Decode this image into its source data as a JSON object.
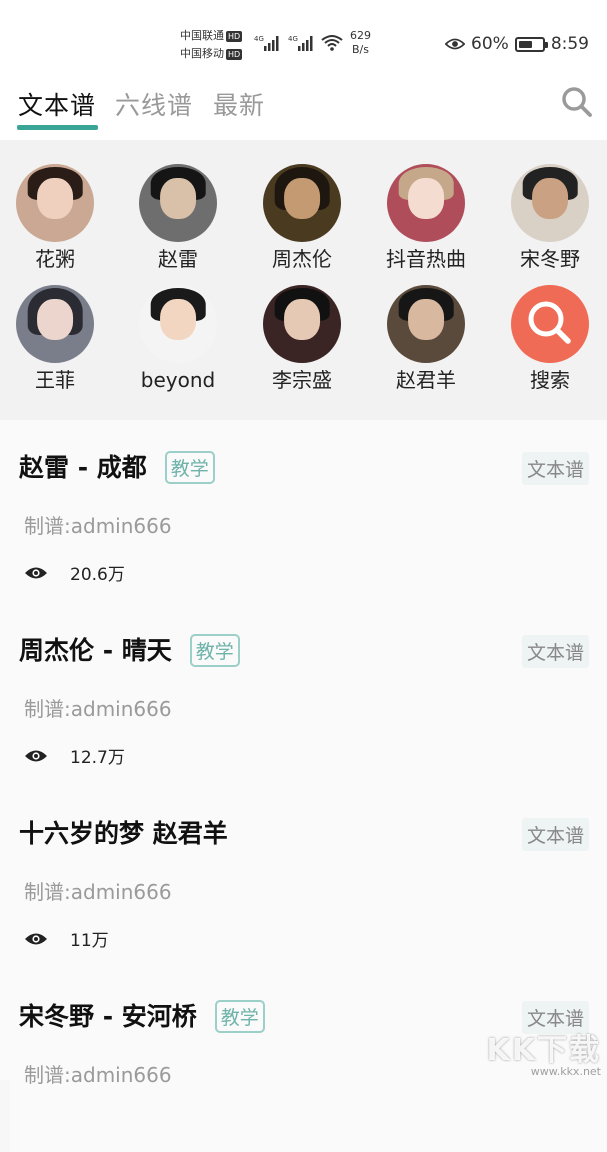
{
  "status_bar": {
    "carrier1": "中国联通",
    "carrier2": "中国移动",
    "hd": "HD",
    "net_type": "4G",
    "net_speed_value": "629",
    "net_speed_unit": "B/s",
    "battery_percent": "60%",
    "battery_level": 0.6,
    "time": "8:59"
  },
  "tabs": [
    {
      "label": "文本谱",
      "active": true
    },
    {
      "label": "六线谱",
      "active": false
    },
    {
      "label": "最新",
      "active": false
    }
  ],
  "accent_color": "#3aa597",
  "artists": [
    {
      "name": "花粥",
      "icon": "avatar-photo"
    },
    {
      "name": "赵雷",
      "icon": "avatar-photo"
    },
    {
      "name": "周杰伦",
      "icon": "avatar-photo"
    },
    {
      "name": "抖音热曲",
      "icon": "avatar-photo"
    },
    {
      "name": "宋冬野",
      "icon": "avatar-photo"
    },
    {
      "name": "王菲",
      "icon": "avatar-photo"
    },
    {
      "name": "beyond",
      "icon": "avatar-photo"
    },
    {
      "name": "李宗盛",
      "icon": "avatar-photo"
    },
    {
      "name": "赵君羊",
      "icon": "avatar-photo"
    },
    {
      "name": "搜索",
      "icon": "search-icon",
      "color": "#ef6b55"
    }
  ],
  "songs": [
    {
      "title": "赵雷 - 成都",
      "badge": "教学",
      "type": "文本谱",
      "author": "制谱:admin666",
      "views": "20.6万"
    },
    {
      "title": "周杰伦 - 晴天",
      "badge": "教学",
      "type": "文本谱",
      "author": "制谱:admin666",
      "views": "12.7万"
    },
    {
      "title": "十六岁的梦 赵君羊",
      "badge": "",
      "type": "文本谱",
      "author": "制谱:admin666",
      "views": "11万"
    },
    {
      "title": "宋冬野 - 安河桥",
      "badge": "教学",
      "type": "文本谱",
      "author": "制谱:admin666",
      "views": ""
    }
  ],
  "watermark": {
    "big": "KK下载",
    "small": "www.kkx.net"
  }
}
